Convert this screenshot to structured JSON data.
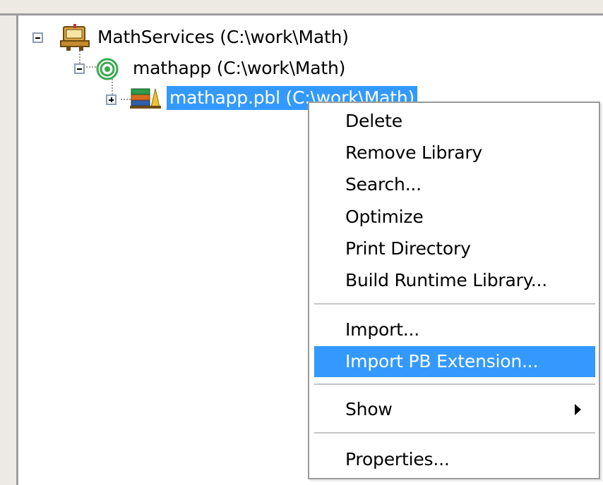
{
  "tree": {
    "workspace": {
      "label": "MathServices (C:\\work\\Math)",
      "expander": "minus",
      "icon": "workspace-icon"
    },
    "target": {
      "label": "mathapp (C:\\work\\Math)",
      "expander": "minus",
      "icon": "target-icon"
    },
    "library": {
      "label": "mathapp.pbl (C:\\work\\Math)",
      "expander": "plus",
      "icon": "library-icon",
      "selected": true
    }
  },
  "context_menu": {
    "items": [
      {
        "label": "Delete"
      },
      {
        "label": "Remove Library"
      },
      {
        "label": "Search..."
      },
      {
        "label": "Optimize"
      },
      {
        "label": "Print Directory"
      },
      {
        "label": "Build Runtime Library..."
      },
      {
        "label": "Import..."
      },
      {
        "label": "Import PB Extension...",
        "highlighted": true
      },
      {
        "label": "Show",
        "submenu": true,
        "submenu_icon": "submenu-arrow-icon"
      },
      {
        "label": "Properties..."
      }
    ]
  },
  "colors": {
    "selection": "#3399ff",
    "frame": "#eceae2",
    "border": "#9d9d9d",
    "target_icon": "#3aa84f"
  }
}
